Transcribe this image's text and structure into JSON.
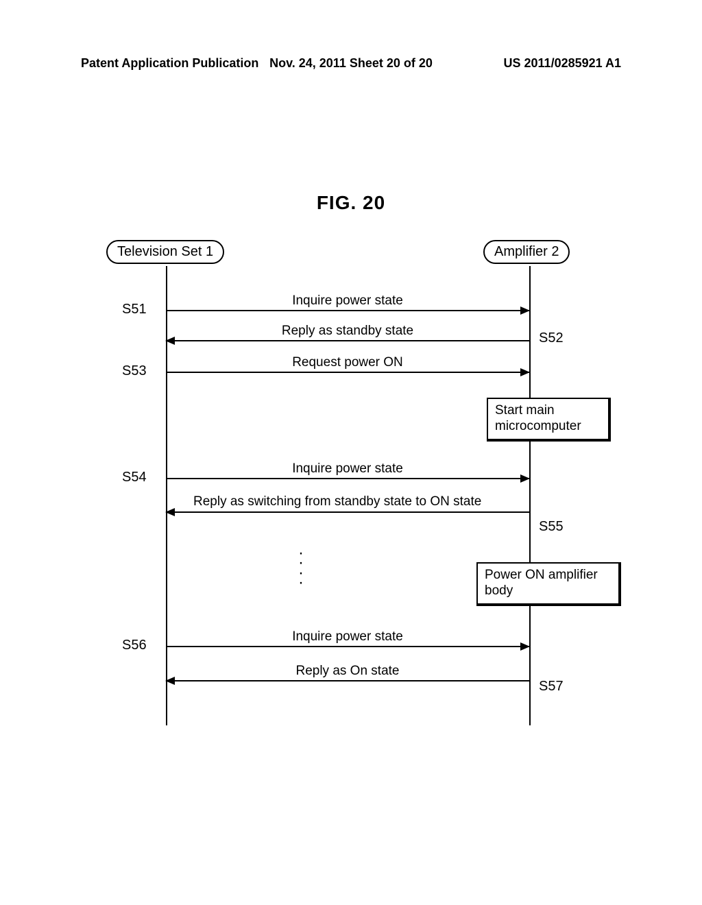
{
  "header": {
    "left": "Patent Application Publication",
    "center": "Nov. 24, 2011  Sheet 20 of 20",
    "right": "US 2011/0285921 A1"
  },
  "figure": {
    "title": "FIG. 20",
    "actors": {
      "tv": "Television Set 1",
      "amp": "Amplifier 2"
    },
    "steps": {
      "s51": {
        "label": "S51",
        "text": "Inquire power state"
      },
      "s52": {
        "label": "S52",
        "text": "Reply as standby state"
      },
      "s53": {
        "label": "S53",
        "text": "Request power ON"
      },
      "s54": {
        "label": "S54",
        "text": "Inquire power state"
      },
      "s55": {
        "label": "S55",
        "text": "Reply as switching from standby state to ON state"
      },
      "s56": {
        "label": "S56",
        "text": "Inquire power state"
      },
      "s57": {
        "label": "S57",
        "text": "Reply as On state"
      }
    },
    "processes": {
      "p1": "Start main\nmicrocomputer",
      "p2": "Power ON amplifier\nbody"
    }
  }
}
